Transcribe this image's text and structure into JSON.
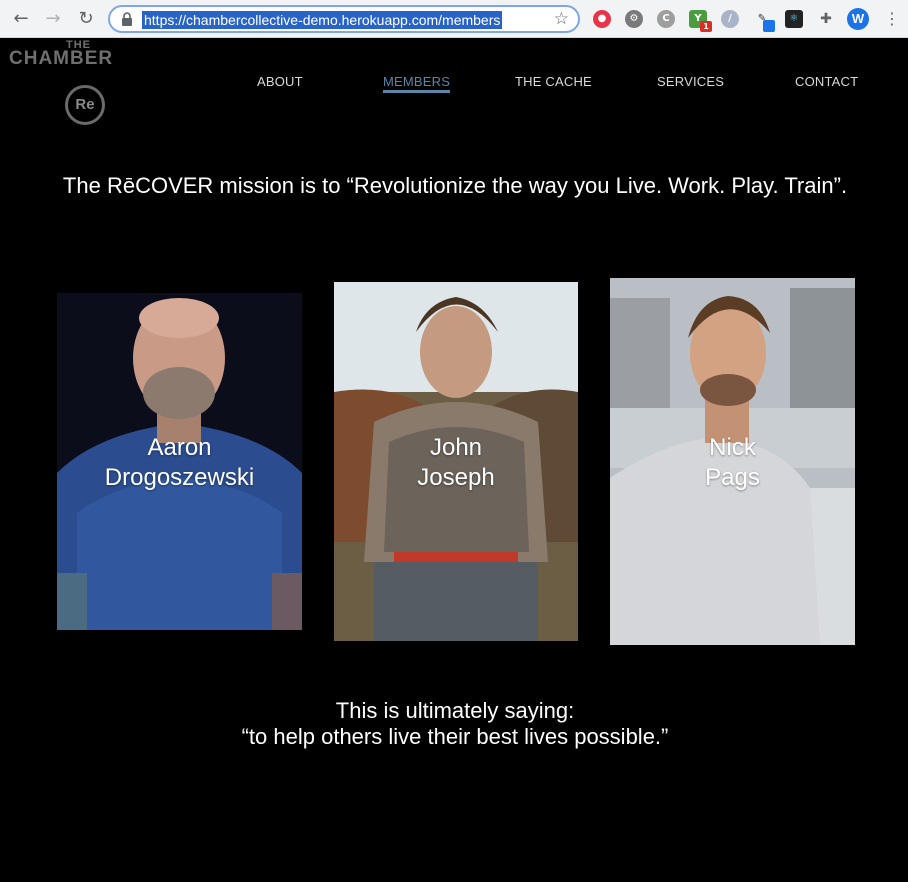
{
  "browser": {
    "url": "https://chambercollective-demo.herokuapp.com/members",
    "back_icon": "←",
    "forward_icon": "→",
    "reload_icon": "↻",
    "star_icon": "☆",
    "profile_initial": "W",
    "ext_badge": "1"
  },
  "logo": {
    "the": "THE",
    "chamber": "CHAMBER",
    "mark": "Re"
  },
  "nav": {
    "items": [
      "ABOUT",
      "MEMBERS",
      "THE CACHE",
      "SERVICES",
      "CONTACT"
    ],
    "active": "MEMBERS"
  },
  "mission": {
    "text": "The RēCOVER mission is to “Revolutionize the way you Live. Work. Play. Train”."
  },
  "members": [
    {
      "first": "Aaron",
      "last": "Drogoszewski"
    },
    {
      "first": "John",
      "last": "Joseph"
    },
    {
      "first": "Nick",
      "last": "Pags"
    }
  ],
  "closing": {
    "line1": "This is ultimately saying:",
    "line2": "“to help others live their best lives possible.”"
  },
  "colors": {
    "background": "#000000",
    "accent": "#5a86a8",
    "text": "#ffffff"
  }
}
